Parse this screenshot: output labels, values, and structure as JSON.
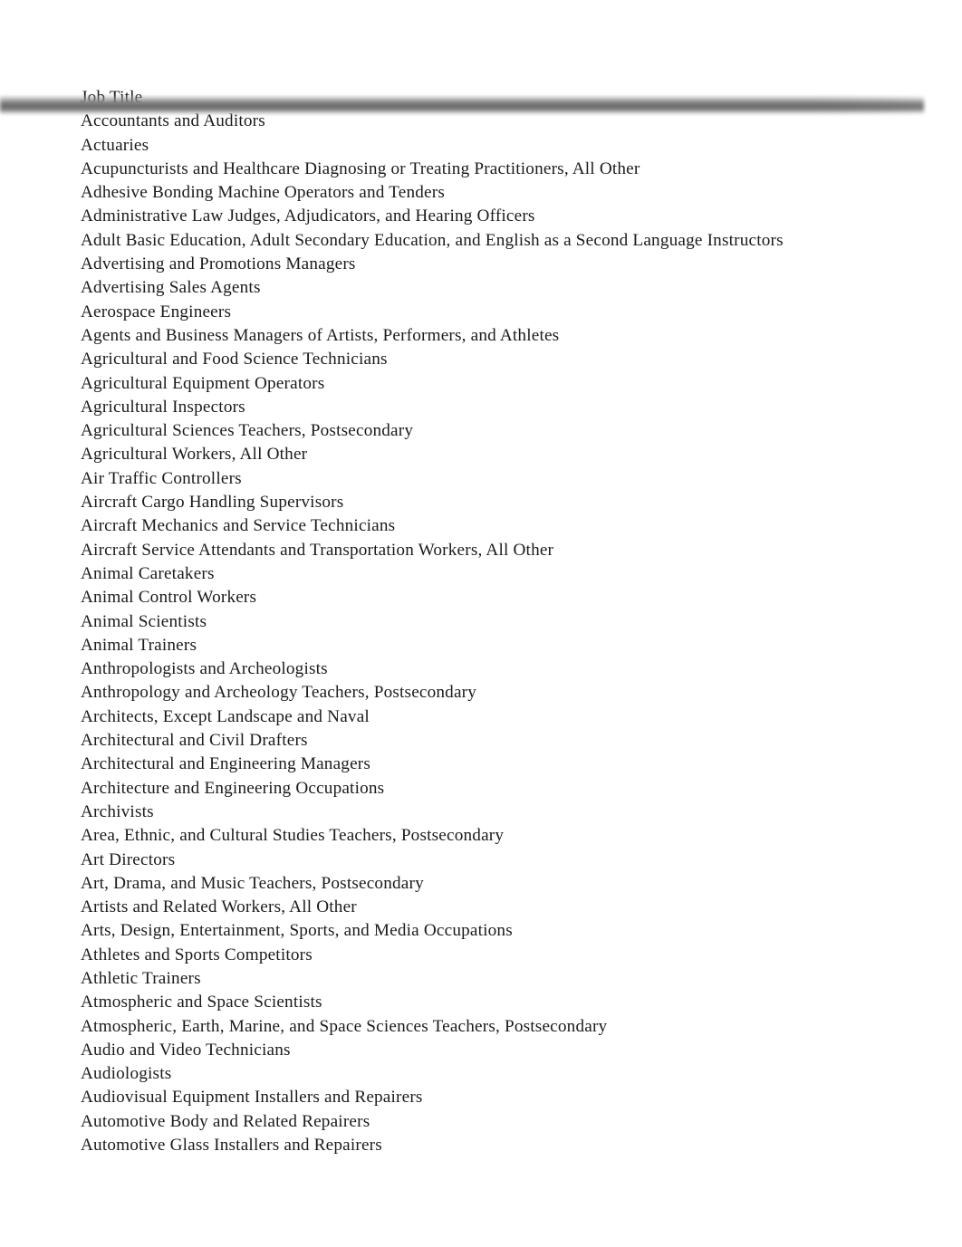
{
  "document": {
    "column_header": "Job Title",
    "page_background": "#ffffff",
    "text_color": "#1b1b1b",
    "header_shadow_color": "#eeeef0"
  },
  "table": {
    "header": "Job Title",
    "rows": [
      "Accountants and Auditors",
      "Actuaries",
      "Acupuncturists and Healthcare Diagnosing or Treating Practitioners, All Other",
      "Adhesive Bonding Machine Operators and Tenders",
      "Administrative Law Judges, Adjudicators, and Hearing Officers",
      "Adult Basic Education, Adult Secondary Education, and English as a Second Language Instructors",
      "Advertising and Promotions Managers",
      "Advertising Sales Agents",
      "Aerospace Engineers",
      "Agents and Business Managers of Artists, Performers, and Athletes",
      "Agricultural and Food Science Technicians",
      "Agricultural Equipment Operators",
      "Agricultural Inspectors",
      "Agricultural Sciences Teachers, Postsecondary",
      "Agricultural Workers, All Other",
      "Air Traffic Controllers",
      "Aircraft Cargo Handling Supervisors",
      "Aircraft Mechanics and Service Technicians",
      "Aircraft Service Attendants and Transportation Workers, All Other",
      "Animal Caretakers",
      "Animal Control Workers",
      "Animal Scientists",
      "Animal Trainers",
      "Anthropologists and Archeologists",
      "Anthropology and Archeology Teachers, Postsecondary",
      "Architects, Except Landscape and Naval",
      "Architectural and Civil Drafters",
      "Architectural and Engineering Managers",
      "Architecture and Engineering Occupations",
      "Archivists",
      "Area, Ethnic, and Cultural Studies Teachers, Postsecondary",
      "Art Directors",
      "Art, Drama, and Music Teachers, Postsecondary",
      "Artists and Related Workers, All Other",
      "Arts, Design, Entertainment, Sports, and Media Occupations",
      "Athletes and Sports Competitors",
      "Athletic Trainers",
      "Atmospheric and Space Scientists",
      "Atmospheric, Earth, Marine, and Space Sciences Teachers, Postsecondary",
      "Audio and Video Technicians",
      "Audiologists",
      "Audiovisual Equipment Installers and Repairers",
      "Automotive Body and Related Repairers",
      "Automotive Glass Installers and Repairers"
    ]
  }
}
